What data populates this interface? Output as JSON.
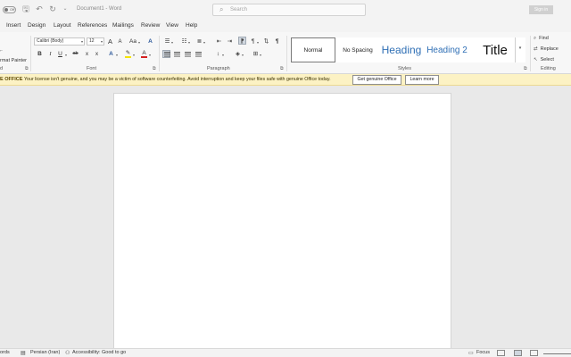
{
  "titlebar": {
    "autosave_toggle": "Off",
    "document_title": "Document1  -  Word",
    "search_placeholder": "Search",
    "signin_label": "Sign in"
  },
  "menu": {
    "items": [
      "Insert",
      "Design",
      "Layout",
      "References",
      "Mailings",
      "Review",
      "View",
      "Help"
    ]
  },
  "ribbon": {
    "clipboard": {
      "group_label": "d",
      "format_painter": "rmat Painter"
    },
    "font": {
      "group_label": "Font",
      "font_name": "Calibri (Body)",
      "font_size": "12",
      "grow_label": "A",
      "shrink_label": "A",
      "case_label": "Aa",
      "bold": "B",
      "italic": "I",
      "underline": "U",
      "strikethrough": "ab",
      "subscript": "x",
      "superscript": "x",
      "effects": "A",
      "font_color_label": "A",
      "highlight_color": "#f5e400",
      "font_color": "#d42020"
    },
    "paragraph": {
      "group_label": "Paragraph"
    },
    "styles": {
      "group_label": "Styles",
      "items": [
        "Normal",
        "No Spacing",
        "Heading",
        "Heading 2",
        "Title"
      ]
    },
    "editing": {
      "group_label": "Editing",
      "find": "Find",
      "replace": "Replace",
      "select": "Select"
    }
  },
  "infobar": {
    "title": "E OFFICE",
    "message": "Your license isn't genuine, and you may be a victim of software counterfeiting. Avoid interruption and keep your files safe with genuine Office today.",
    "get_genuine_button": "Get genuine Office",
    "learn_more_button": "Learn more"
  },
  "statusbar": {
    "words": "ords",
    "language": "Persian (Iran)",
    "accessibility": "Accessibility: Good to go",
    "focus": "Focus"
  }
}
